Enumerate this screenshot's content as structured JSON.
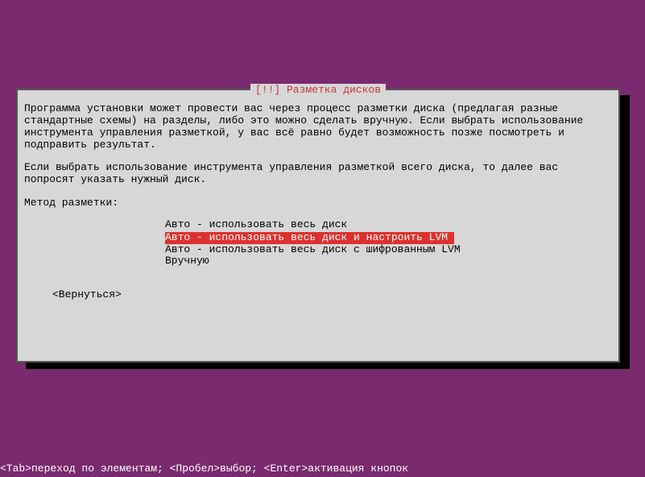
{
  "dialog": {
    "title": "[!!] Разметка дисков",
    "paragraph1": "Программа установки может провести вас через процесс разметки диска (предлагая разные стандартные схемы) на разделы, либо это можно сделать вручную. Если выбрать использование инструмента управления разметкой, у вас всё равно будет возможность позже посмотреть и подправить результат.",
    "paragraph2": "Если выбрать использование инструмента управления разметкой всего диска, то далее вас попросят указать нужный диск.",
    "prompt": "Метод разметки:",
    "options": [
      {
        "label": "Авто - использовать весь диск",
        "selected": false
      },
      {
        "label": "Авто - использовать весь диск и настроить LVM",
        "selected": true
      },
      {
        "label": "Авто - использовать весь диск с шифрованным LVM",
        "selected": false
      },
      {
        "label": "Вручную",
        "selected": false
      }
    ],
    "back_label": "<Вернуться>"
  },
  "footer": {
    "hint": "<Tab>переход по элементам; <Пробел>выбор; <Enter>активация кнопок"
  }
}
